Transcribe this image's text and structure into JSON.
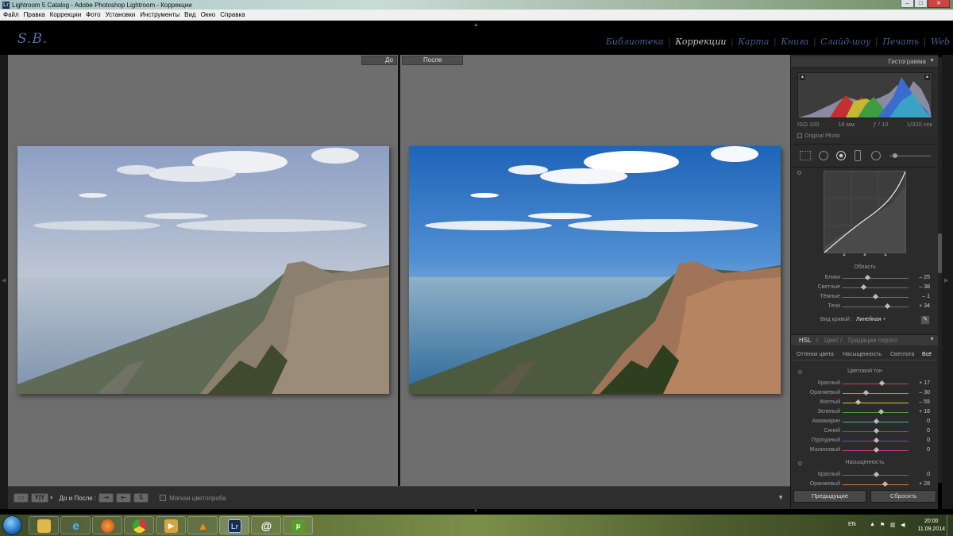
{
  "window": {
    "title": "Lightroom 5 Catalog - Adobe Photoshop Lightroom - Коррекции",
    "app_icon": "Lr",
    "buttons": {
      "minimize": "–",
      "maximize": "□",
      "close": "✕"
    }
  },
  "menu": [
    "Файл",
    "Правка",
    "Коррекции",
    "Фото",
    "Установки",
    "Инструменты",
    "Вид",
    "Окно",
    "Справка"
  ],
  "identity_plate": "S.B.",
  "modules": [
    {
      "label": "Библиотека",
      "active": false
    },
    {
      "label": "Коррекции",
      "active": true
    },
    {
      "label": "Карта",
      "active": false
    },
    {
      "label": "Книга",
      "active": false
    },
    {
      "label": "Слайд-шоу",
      "active": false
    },
    {
      "label": "Печать",
      "active": false
    },
    {
      "label": "Web",
      "active": false
    }
  ],
  "view": {
    "before_label": "До",
    "after_label": "После"
  },
  "toolbar": {
    "yy_label": "Y|Y",
    "before_after_label": "До и После :",
    "soft_proof_label": "Мягкая цветопроба"
  },
  "panel": {
    "histogram": {
      "title": "Гистограмма",
      "iso": "ISO 100",
      "focal": "18 мм",
      "aperture": "ƒ / 10",
      "shutter": "1/320 сек",
      "original_photo": "Original Photo"
    },
    "tone_curve": {
      "region_label": "Область",
      "sliders": [
        {
          "label": "Блики",
          "value": "– 25",
          "num": -25
        },
        {
          "label": "Светлые",
          "value": "– 38",
          "num": -38
        },
        {
          "label": "Тёмные",
          "value": "– 1",
          "num": -1
        },
        {
          "label": "Тени",
          "value": "+ 34",
          "num": 34
        }
      ],
      "curve_type_label": "Вид кривой :",
      "curve_type_value": "Линейная ÷"
    },
    "hsl": {
      "header": [
        "HSL",
        "/",
        "Цвет",
        "/",
        "Градации серого"
      ],
      "tabs": [
        "Оттенок цвета",
        "Насыщенность",
        "Светлота",
        "Всё"
      ],
      "hue_section": "Цветовой тон",
      "hue": [
        {
          "label": "Красный",
          "value": "+ 17",
          "num": 17,
          "color": "#c44"
        },
        {
          "label": "Оранжевый",
          "value": "– 30",
          "num": -30,
          "color": "#d8823a"
        },
        {
          "label": "Желтый",
          "value": "– 55",
          "num": -55,
          "color": "#cfc23a"
        },
        {
          "label": "Зеленый",
          "value": "+ 16",
          "num": 16,
          "color": "#4a9c3a"
        },
        {
          "label": "Аквамарин",
          "value": "0",
          "num": 0,
          "color": "#3ab0a0"
        },
        {
          "label": "Синий",
          "value": "0",
          "num": 0,
          "color": "#3a5cc8"
        },
        {
          "label": "Пурпурный",
          "value": "0",
          "num": 0,
          "color": "#8a3ac8"
        },
        {
          "label": "Малиновый",
          "value": "0",
          "num": 0,
          "color": "#c83a8a"
        }
      ],
      "sat_section": "Насыщенность",
      "saturation": [
        {
          "label": "Красный",
          "value": "0",
          "num": 0,
          "color": "#c44"
        },
        {
          "label": "Оранжевый",
          "value": "+ 28",
          "num": 28,
          "color": "#d8823a"
        }
      ]
    },
    "buttons": {
      "previous": "Предыдущие",
      "reset": "Сбросить"
    }
  },
  "taskbar": {
    "lang": "EN",
    "time": "20:00",
    "date": "11.09.2014",
    "apps": [
      "explorer-icon",
      "ie-icon",
      "firefox-icon",
      "chrome-icon",
      "media-icon",
      "vlc-icon",
      "lightroom-icon",
      "mail-icon",
      "utorrent-icon"
    ]
  }
}
